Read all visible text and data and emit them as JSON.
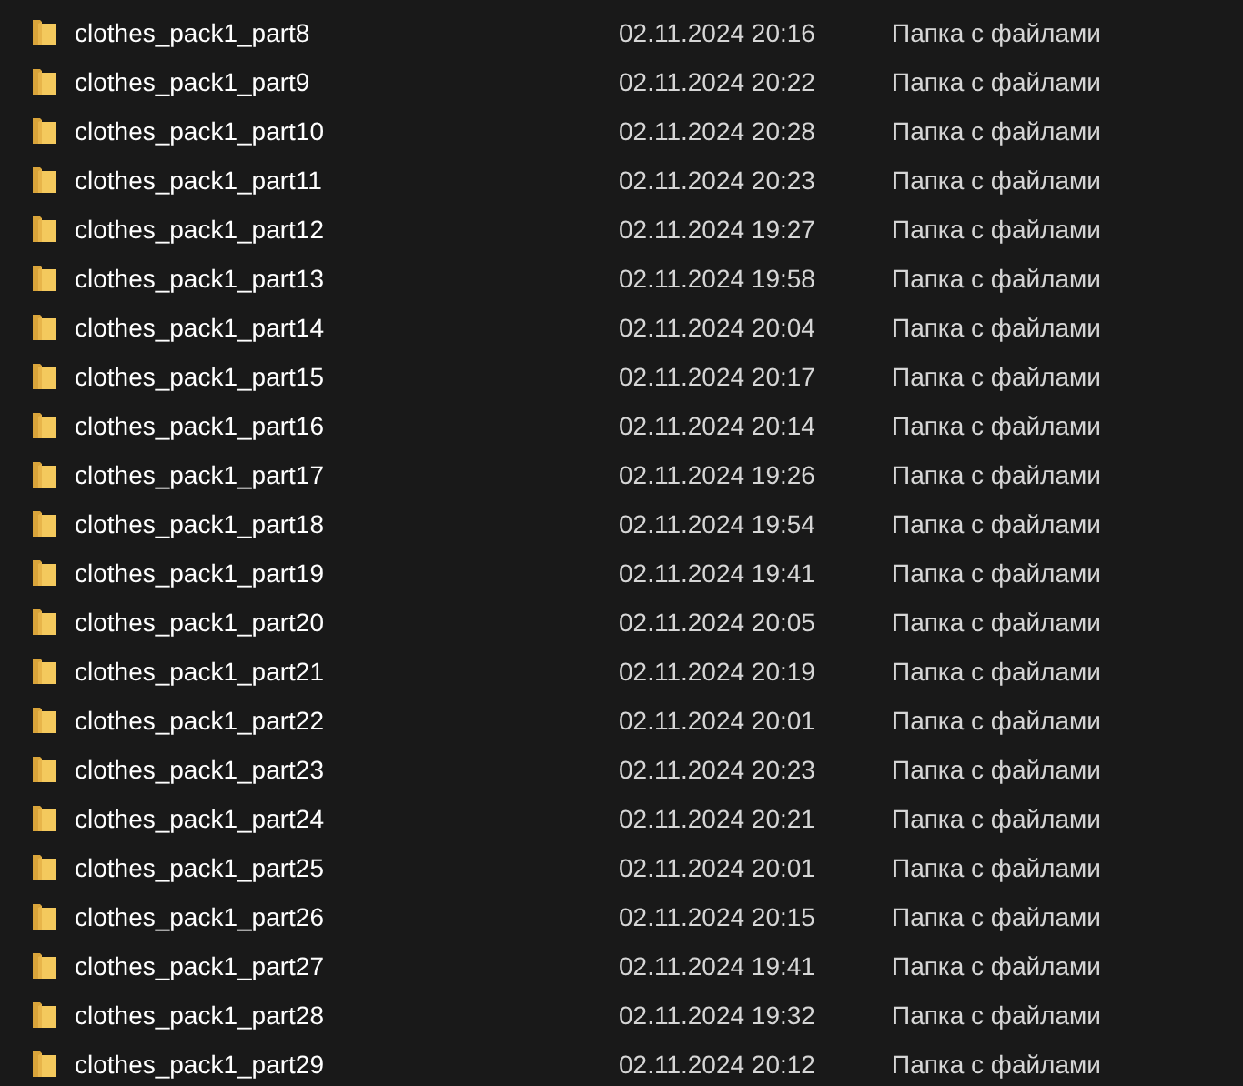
{
  "files": [
    {
      "name": "clothes_pack1_part8",
      "modified": "02.11.2024 20:16",
      "type": "Папка с файлами"
    },
    {
      "name": "clothes_pack1_part9",
      "modified": "02.11.2024 20:22",
      "type": "Папка с файлами"
    },
    {
      "name": "clothes_pack1_part10",
      "modified": "02.11.2024 20:28",
      "type": "Папка с файлами"
    },
    {
      "name": "clothes_pack1_part11",
      "modified": "02.11.2024 20:23",
      "type": "Папка с файлами"
    },
    {
      "name": "clothes_pack1_part12",
      "modified": "02.11.2024 19:27",
      "type": "Папка с файлами"
    },
    {
      "name": "clothes_pack1_part13",
      "modified": "02.11.2024 19:58",
      "type": "Папка с файлами"
    },
    {
      "name": "clothes_pack1_part14",
      "modified": "02.11.2024 20:04",
      "type": "Папка с файлами"
    },
    {
      "name": "clothes_pack1_part15",
      "modified": "02.11.2024 20:17",
      "type": "Папка с файлами"
    },
    {
      "name": "clothes_pack1_part16",
      "modified": "02.11.2024 20:14",
      "type": "Папка с файлами"
    },
    {
      "name": "clothes_pack1_part17",
      "modified": "02.11.2024 19:26",
      "type": "Папка с файлами"
    },
    {
      "name": "clothes_pack1_part18",
      "modified": "02.11.2024 19:54",
      "type": "Папка с файлами"
    },
    {
      "name": "clothes_pack1_part19",
      "modified": "02.11.2024 19:41",
      "type": "Папка с файлами"
    },
    {
      "name": "clothes_pack1_part20",
      "modified": "02.11.2024 20:05",
      "type": "Папка с файлами"
    },
    {
      "name": "clothes_pack1_part21",
      "modified": "02.11.2024 20:19",
      "type": "Папка с файлами"
    },
    {
      "name": "clothes_pack1_part22",
      "modified": "02.11.2024 20:01",
      "type": "Папка с файлами"
    },
    {
      "name": "clothes_pack1_part23",
      "modified": "02.11.2024 20:23",
      "type": "Папка с файлами"
    },
    {
      "name": "clothes_pack1_part24",
      "modified": "02.11.2024 20:21",
      "type": "Папка с файлами"
    },
    {
      "name": "clothes_pack1_part25",
      "modified": "02.11.2024 20:01",
      "type": "Папка с файлами"
    },
    {
      "name": "clothes_pack1_part26",
      "modified": "02.11.2024 20:15",
      "type": "Папка с файлами"
    },
    {
      "name": "clothes_pack1_part27",
      "modified": "02.11.2024 19:41",
      "type": "Папка с файлами"
    },
    {
      "name": "clothes_pack1_part28",
      "modified": "02.11.2024 19:32",
      "type": "Папка с файлами"
    },
    {
      "name": "clothes_pack1_part29",
      "modified": "02.11.2024 20:12",
      "type": "Папка с файлами"
    }
  ]
}
